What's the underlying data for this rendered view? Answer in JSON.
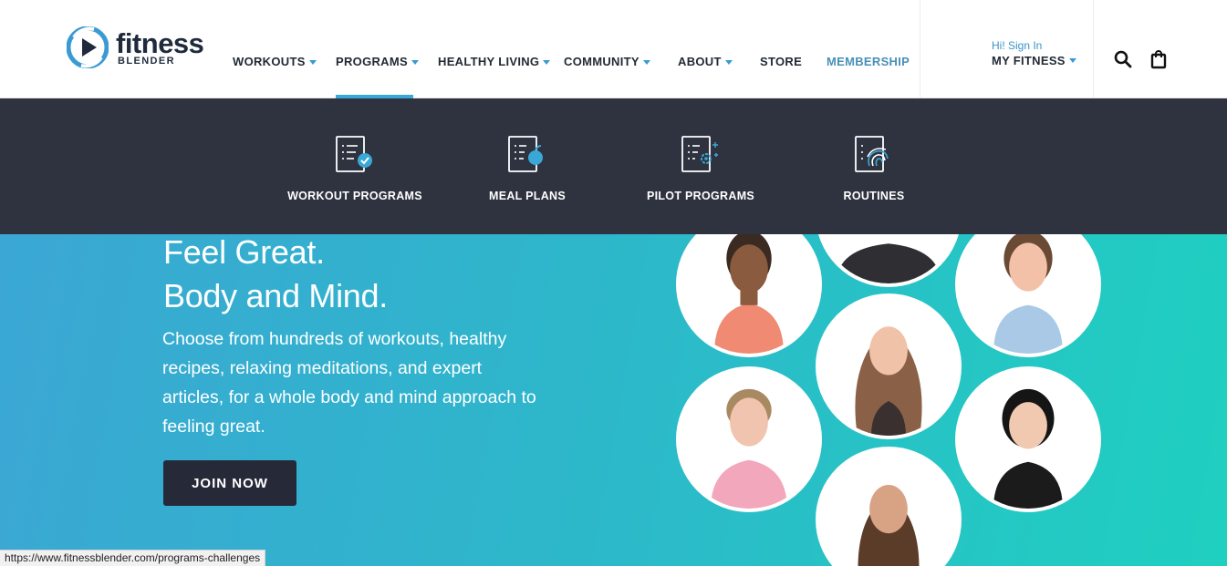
{
  "brand": {
    "word": "fitness",
    "sub": "BLENDER",
    "colors": {
      "blue": "#3a9bd2",
      "navy": "#1f2b3d"
    }
  },
  "nav": {
    "items": [
      {
        "label": "WORKOUTS",
        "has_caret": true
      },
      {
        "label": "PROGRAMS",
        "has_caret": true,
        "active": true
      },
      {
        "label": "HEALTHY LIVING",
        "has_caret": true
      },
      {
        "label": "COMMUNITY",
        "has_caret": true
      },
      {
        "label": "ABOUT",
        "has_caret": true
      },
      {
        "label": "STORE",
        "has_caret": false
      },
      {
        "label": "MEMBERSHIP",
        "has_caret": false
      }
    ]
  },
  "account": {
    "greeting": "Hi! Sign In",
    "label": "MY FITNESS"
  },
  "icons": {
    "search": "search-icon",
    "cart": "shopping-bag-icon"
  },
  "dropdown": {
    "items": [
      {
        "label": "WORKOUT PROGRAMS",
        "icon": "checklist-check-icon"
      },
      {
        "label": "MEAL PLANS",
        "icon": "checklist-apple-icon"
      },
      {
        "label": "PILOT PROGRAMS",
        "icon": "checklist-gear-icon"
      },
      {
        "label": "ROUTINES",
        "icon": "checklist-fingerprint-icon"
      }
    ]
  },
  "hero": {
    "headline_1": "Feel Great.",
    "headline_2": "Body and Mind.",
    "subtext": "Choose from hundreds of workouts, healthy recipes, relaxing meditations, and expert articles, for a whole body and mind approach to feeling great.",
    "cta": "JOIN NOW",
    "avatars": [
      "trainer-1",
      "trainer-2",
      "trainer-3",
      "trainer-4",
      "trainer-5",
      "trainer-6",
      "trainer-7"
    ]
  },
  "status_url": "https://www.fitnessblender.com/programs-challenges"
}
